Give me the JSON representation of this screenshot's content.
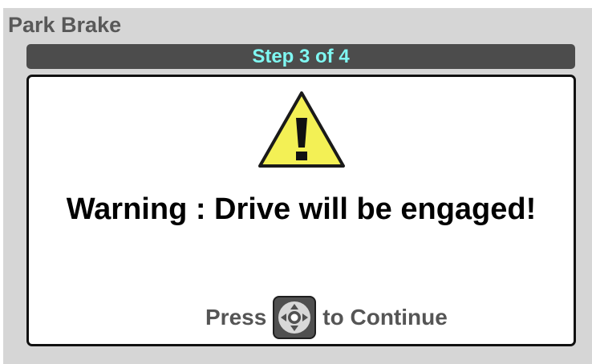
{
  "header": {
    "title": "Park Brake"
  },
  "step": {
    "label": "Step 3 of 4"
  },
  "dialog": {
    "icon": "warning-triangle-icon",
    "message": "Warning : Drive will be engaged!",
    "prompt_before": "Press",
    "prompt_icon": "directional-pad-icon",
    "prompt_after": "to Continue"
  },
  "colors": {
    "screen_background": "#d6d6d6",
    "title_text": "#585858",
    "step_bar": "#4c4c4c",
    "step_text": "#7ff7f2",
    "warning_fill": "#f3f055",
    "prompt_text": "#555555"
  }
}
